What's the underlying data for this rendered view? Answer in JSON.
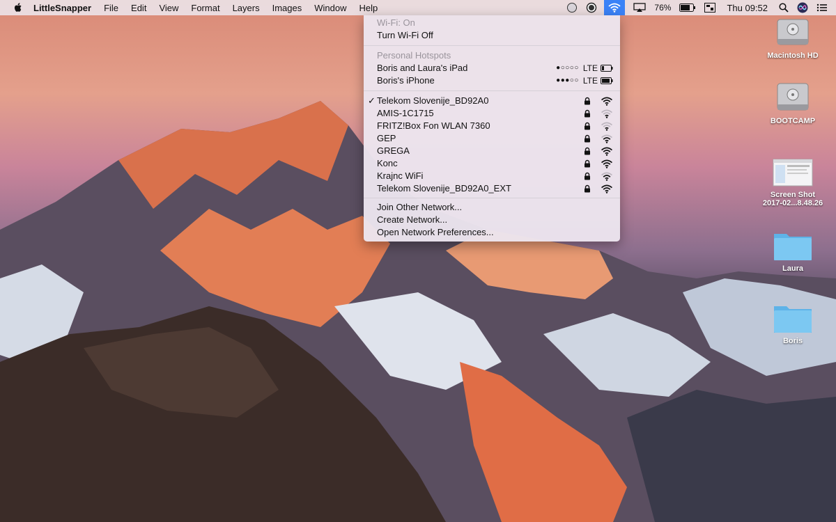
{
  "menubar": {
    "app_name": "LittleSnapper",
    "menus": [
      "File",
      "Edit",
      "View",
      "Format",
      "Layers",
      "Images",
      "Window",
      "Help"
    ],
    "battery_pct": "76%",
    "clock": "Thu 09:52"
  },
  "wifi_menu": {
    "status_header": "Wi-Fi: On",
    "toggle_label": "Turn Wi-Fi Off",
    "hotspots_header": "Personal Hotspots",
    "hotspots": [
      {
        "name": "Boris and Laura's iPad",
        "signal": "●○○○○",
        "network": "LTE",
        "battery_level": 0.2
      },
      {
        "name": "Boris's iPhone",
        "signal": "●●●○○",
        "network": "LTE",
        "battery_level": 0.8
      }
    ],
    "networks": [
      {
        "name": "Telekom Slovenije_BD92A0",
        "checked": "✓",
        "signal_level": 3
      },
      {
        "name": "AMIS-1C1715",
        "checked": "",
        "signal_level": 1
      },
      {
        "name": "FRITZ!Box Fon WLAN 7360",
        "checked": "",
        "signal_level": 1
      },
      {
        "name": "GEP",
        "checked": "",
        "signal_level": 2
      },
      {
        "name": "GREGA",
        "checked": "",
        "signal_level": 3
      },
      {
        "name": "Konc",
        "checked": "",
        "signal_level": 3
      },
      {
        "name": "Krajnc WiFi",
        "checked": "",
        "signal_level": 2
      },
      {
        "name": "Telekom Slovenije_BD92A0_EXT",
        "checked": "",
        "signal_level": 3
      }
    ],
    "actions": [
      "Join Other Network...",
      "Create Network...",
      "Open Network Preferences..."
    ]
  },
  "desktop_icons": [
    {
      "label": "Macintosh HD",
      "icon": "hard-drive-icon"
    },
    {
      "label": "BOOTCAMP",
      "icon": "hard-drive-icon"
    },
    {
      "label": "Screen Shot\n2017-02...8.48.26",
      "line1": "Screen Shot",
      "line2": "2017-02...8.48.26",
      "icon": "screenshot-thumbnail-icon"
    },
    {
      "label": "Laura",
      "icon": "folder-icon"
    },
    {
      "label": "Boris",
      "icon": "folder-icon"
    }
  ],
  "colors": {
    "wifi_highlight": "#3a82f7",
    "folder": "#6ec0ef"
  }
}
